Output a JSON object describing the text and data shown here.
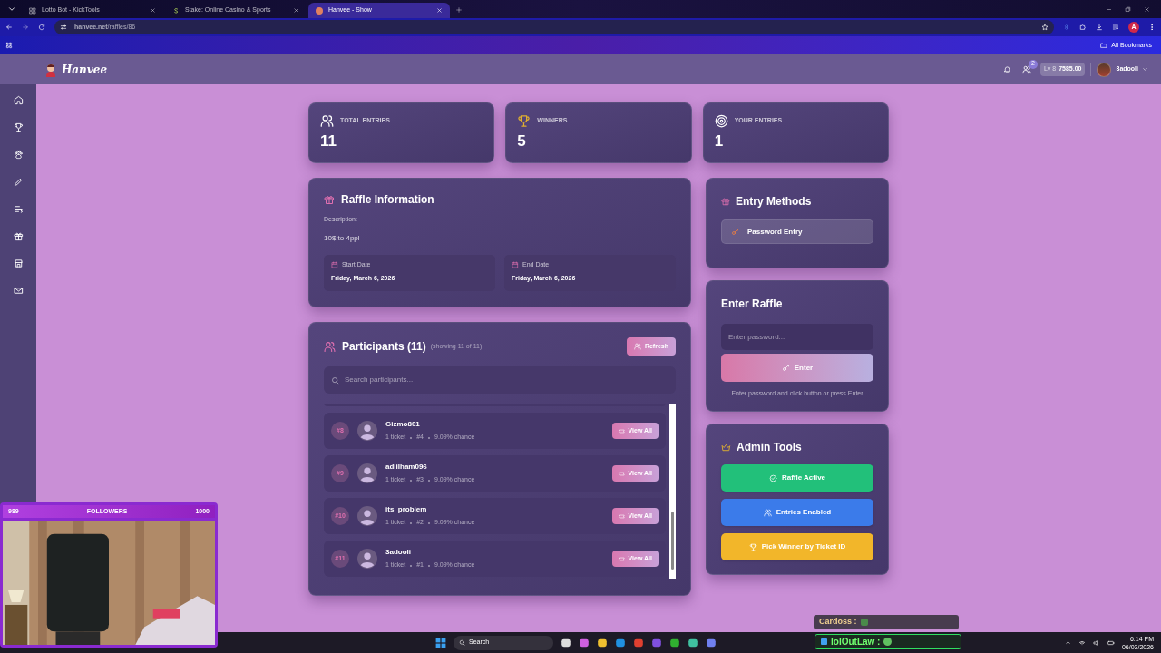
{
  "browser": {
    "tabs": [
      {
        "title": "Lotto Bot - KickTools",
        "kind": "grid",
        "selected": false
      },
      {
        "title": "Stake: Online Casino & Sports",
        "kind": "letter",
        "selected": false
      },
      {
        "title": "Hanvee - Show",
        "kind": "avatar",
        "selected": true
      }
    ],
    "url": "**hanvee.net**/raffles/86",
    "profile_initial": "A",
    "bookmarks_label": "All Bookmarks"
  },
  "header": {
    "logo": "Hanvee",
    "friend_requests": "2",
    "level": "Lv 8",
    "balance": "7585.00",
    "username": "3adooli"
  },
  "sidebar": {
    "items": [
      {
        "kind": "home"
      },
      {
        "kind": "trophy"
      },
      {
        "kind": "paw"
      },
      {
        "kind": "pencil"
      },
      {
        "kind": "list"
      },
      {
        "kind": "gift"
      },
      {
        "kind": "store"
      },
      {
        "kind": "mail"
      }
    ]
  },
  "stats": [
    {
      "kind": "users",
      "label": "TOTAL ENTRIES",
      "value": "11"
    },
    {
      "kind": "trophy",
      "label": "WINNERS",
      "value": "5"
    },
    {
      "kind": "target",
      "label": "YOUR ENTRIES",
      "value": "1"
    }
  ],
  "raffle_info": {
    "title": "Raffle Information",
    "description_label": "Description:",
    "description": "10$ to 4ppl",
    "dates": [
      {
        "label": "Start Date",
        "value": "Friday, March 6, 2026"
      },
      {
        "label": "End Date",
        "value": "Friday, March 6, 2026"
      }
    ]
  },
  "participants": {
    "title": "Participants (11)",
    "subtitle": "(showing 11 of 11)",
    "refresh": "Refresh",
    "search_placeholder": "Search participants...",
    "rows": [
      {
        "rank": "#8",
        "name": "Gizmo801",
        "tickets": "1 ticket",
        "ticket_no": "#4",
        "chance": "9.09% chance",
        "action": "View All"
      },
      {
        "rank": "#9",
        "name": "adiilham096",
        "tickets": "1 ticket",
        "ticket_no": "#3",
        "chance": "9.09% chance",
        "action": "View All"
      },
      {
        "rank": "#10",
        "name": "its_problem",
        "tickets": "1 ticket",
        "ticket_no": "#2",
        "chance": "9.09% chance",
        "action": "View All"
      },
      {
        "rank": "#11",
        "name": "3adooli",
        "tickets": "1 ticket",
        "ticket_no": "#1",
        "chance": "9.09% chance",
        "action": "View All"
      }
    ]
  },
  "entry_methods": {
    "title": "Entry Methods",
    "methods": [
      {
        "label": "Password Entry"
      }
    ]
  },
  "enter_raffle": {
    "title": "Enter Raffle",
    "placeholder": "Enter password...",
    "button": "Enter",
    "hint": "Enter password and click button or press Enter"
  },
  "admin_tools": {
    "title": "Admin Tools",
    "buttons": [
      {
        "label": "Raffle Active",
        "kind": "check",
        "color": "#22c07a"
      },
      {
        "label": "Entries Enabled",
        "kind": "users",
        "color": "#3b7bea"
      },
      {
        "label": "Pick Winner by Ticket ID",
        "kind": "trophy",
        "color": "#f2b62a"
      }
    ]
  },
  "stream_overlay": {
    "followers_current": "989",
    "followers_label": "FOLLOWERS",
    "followers_goal": "1000",
    "chat": [
      {
        "user": "Cardoss :"
      },
      {
        "user": "lolOutLaw :"
      }
    ]
  },
  "taskbar": {
    "search": "Search",
    "time": "6:14 PM",
    "date": "06/03/2026"
  }
}
